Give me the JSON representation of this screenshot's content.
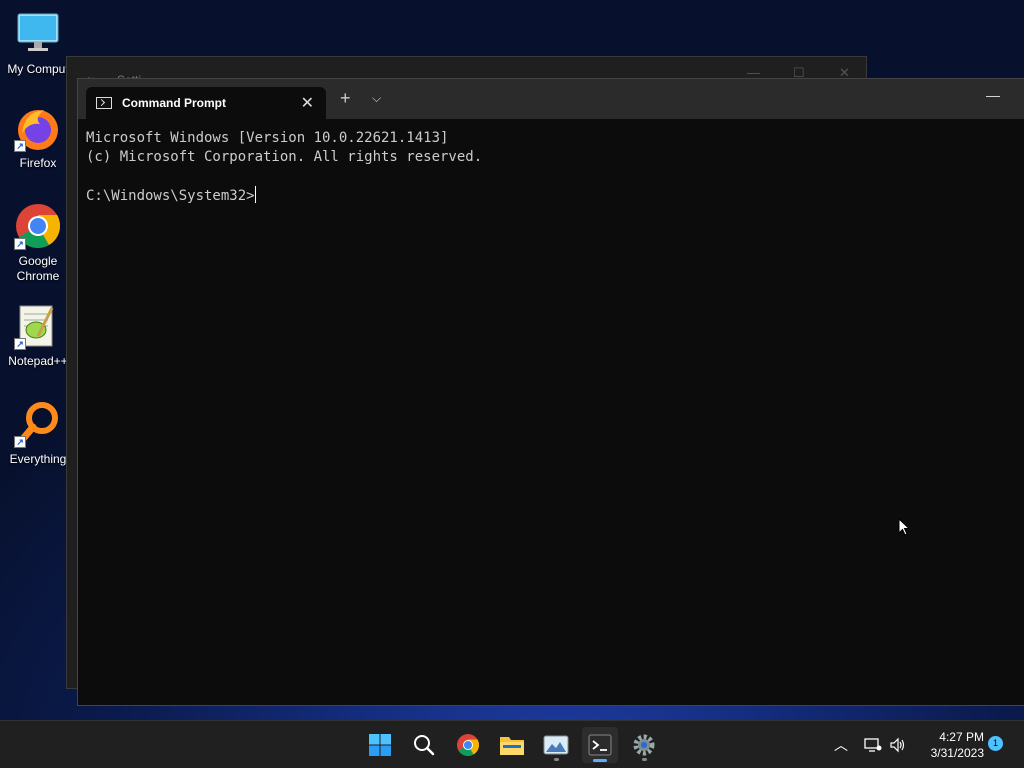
{
  "desktop": {
    "icons": [
      {
        "label": "My Comput",
        "icon": "monitor-icon"
      },
      {
        "label": "Firefox",
        "icon": "firefox-icon"
      },
      {
        "label": "Google Chrome",
        "icon": "chrome-icon"
      },
      {
        "label": "Notepad++",
        "icon": "notepadpp-icon"
      },
      {
        "label": "Everything",
        "icon": "everything-search-icon"
      }
    ]
  },
  "background_window": {
    "title": "Setti..."
  },
  "terminal": {
    "tab_title": "Command Prompt",
    "close_glyph": "✕",
    "new_tab_glyph": "+",
    "dropdown_glyph": "⌵",
    "minimize_glyph": "—",
    "lines": [
      "Microsoft Windows [Version 10.0.22621.1413]",
      "(c) Microsoft Corporation. All rights reserved.",
      "",
      "C:\\Windows\\System32>"
    ]
  },
  "taskbar": {
    "apps": [
      "start-icon",
      "search-icon",
      "chrome-icon",
      "file-explorer-icon",
      "photos-icon",
      "terminal-icon",
      "settings-icon"
    ],
    "clock_time": "4:27 PM",
    "clock_date": "3/31/2023",
    "notification_count": "1"
  },
  "colors": {
    "accent": "#5ab0ff",
    "terminal_bg": "#0c0c0c",
    "terminal_text": "#cccccc",
    "taskbar_bg": "#202020"
  }
}
